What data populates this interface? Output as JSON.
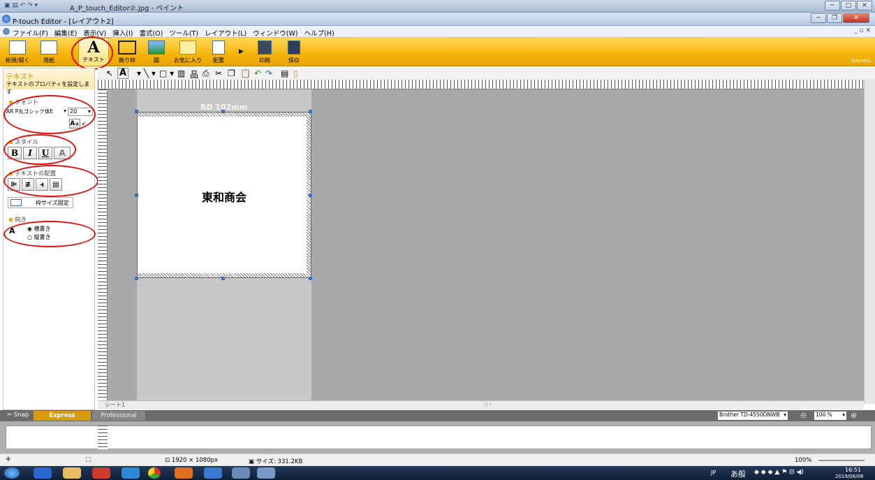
{
  "paint_window": {
    "title": "A_P_touch_Editor②.jpg - ペイント"
  },
  "app": {
    "title": "P-touch Editor - [レイアウト2]"
  },
  "menu": [
    "ファイル(F)",
    "編集(E)",
    "表示(V)",
    "挿入(I)",
    "書式(O)",
    "ツール(T)",
    "レイアウト(L)",
    "ウィンドウ(W)",
    "ヘルプ(H)"
  ],
  "ribbon": {
    "buttons": [
      {
        "label": "新規/開く",
        "icon": "new-open-icon"
      },
      {
        "label": "用紙",
        "icon": "paper-icon"
      },
      {
        "label": "テキスト",
        "icon": "text-A-icon"
      },
      {
        "label": "飾り枠",
        "icon": "frame-icon"
      },
      {
        "label": "図",
        "icon": "image-icon"
      },
      {
        "label": "お気に入り",
        "icon": "favorites-folder-icon"
      },
      {
        "label": "配置",
        "icon": "arrange-icon"
      },
      {
        "label": "印刷",
        "icon": "print-icon"
      },
      {
        "label": "保存",
        "icon": "save-icon"
      }
    ],
    "express_tag": "Express"
  },
  "properties": {
    "title": "テキスト",
    "subtitle": "テキストのプロパティを設定します",
    "font_section": "フォント",
    "font_name": "AR P丸ゴシック体E",
    "font_size": "20",
    "style_section": "スタイル",
    "bold": "B",
    "italic": "I",
    "underline": "U",
    "outline": "A",
    "align_section": "テキストの配置",
    "fixed_size": "枠サイズ固定",
    "direction_section": "向き",
    "horizontal": "横書き",
    "vertical": "縦書き"
  },
  "canvas": {
    "label_name": "RD 102mm",
    "label_text": "東和商会",
    "sheet_tab": "シート1"
  },
  "modebar": {
    "snap": "Snap",
    "express": "Express",
    "professional": "Professional",
    "printer": "Brother TD-4550DNWB",
    "zoom": "100 %"
  },
  "paint_status": {
    "dimensions": "1920 × 1080px",
    "size": "サイズ: 331.2KB",
    "zoom": "100%"
  },
  "taskbar": {
    "time": "16:51",
    "date": "2019/08/08",
    "ime": "JP",
    "ime_chars": "あ般"
  }
}
